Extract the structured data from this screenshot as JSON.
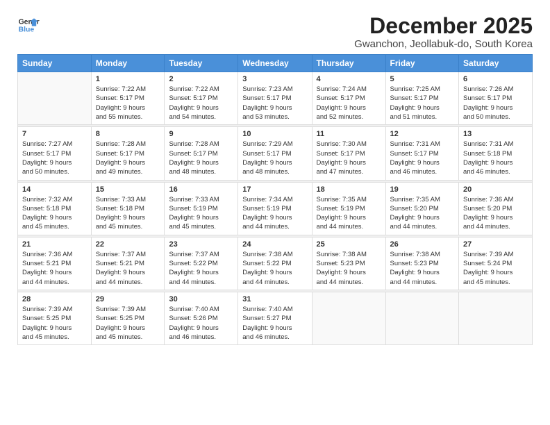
{
  "logo": {
    "general": "General",
    "blue": "Blue"
  },
  "title": "December 2025",
  "subtitle": "Gwanchon, Jeollabuk-do, South Korea",
  "days_header": [
    "Sunday",
    "Monday",
    "Tuesday",
    "Wednesday",
    "Thursday",
    "Friday",
    "Saturday"
  ],
  "weeks": [
    [
      {
        "day": "",
        "info": ""
      },
      {
        "day": "1",
        "info": "Sunrise: 7:22 AM\nSunset: 5:17 PM\nDaylight: 9 hours\nand 55 minutes."
      },
      {
        "day": "2",
        "info": "Sunrise: 7:22 AM\nSunset: 5:17 PM\nDaylight: 9 hours\nand 54 minutes."
      },
      {
        "day": "3",
        "info": "Sunrise: 7:23 AM\nSunset: 5:17 PM\nDaylight: 9 hours\nand 53 minutes."
      },
      {
        "day": "4",
        "info": "Sunrise: 7:24 AM\nSunset: 5:17 PM\nDaylight: 9 hours\nand 52 minutes."
      },
      {
        "day": "5",
        "info": "Sunrise: 7:25 AM\nSunset: 5:17 PM\nDaylight: 9 hours\nand 51 minutes."
      },
      {
        "day": "6",
        "info": "Sunrise: 7:26 AM\nSunset: 5:17 PM\nDaylight: 9 hours\nand 50 minutes."
      }
    ],
    [
      {
        "day": "7",
        "info": "Sunrise: 7:27 AM\nSunset: 5:17 PM\nDaylight: 9 hours\nand 50 minutes."
      },
      {
        "day": "8",
        "info": "Sunrise: 7:28 AM\nSunset: 5:17 PM\nDaylight: 9 hours\nand 49 minutes."
      },
      {
        "day": "9",
        "info": "Sunrise: 7:28 AM\nSunset: 5:17 PM\nDaylight: 9 hours\nand 48 minutes."
      },
      {
        "day": "10",
        "info": "Sunrise: 7:29 AM\nSunset: 5:17 PM\nDaylight: 9 hours\nand 48 minutes."
      },
      {
        "day": "11",
        "info": "Sunrise: 7:30 AM\nSunset: 5:17 PM\nDaylight: 9 hours\nand 47 minutes."
      },
      {
        "day": "12",
        "info": "Sunrise: 7:31 AM\nSunset: 5:17 PM\nDaylight: 9 hours\nand 46 minutes."
      },
      {
        "day": "13",
        "info": "Sunrise: 7:31 AM\nSunset: 5:18 PM\nDaylight: 9 hours\nand 46 minutes."
      }
    ],
    [
      {
        "day": "14",
        "info": "Sunrise: 7:32 AM\nSunset: 5:18 PM\nDaylight: 9 hours\nand 45 minutes."
      },
      {
        "day": "15",
        "info": "Sunrise: 7:33 AM\nSunset: 5:18 PM\nDaylight: 9 hours\nand 45 minutes."
      },
      {
        "day": "16",
        "info": "Sunrise: 7:33 AM\nSunset: 5:19 PM\nDaylight: 9 hours\nand 45 minutes."
      },
      {
        "day": "17",
        "info": "Sunrise: 7:34 AM\nSunset: 5:19 PM\nDaylight: 9 hours\nand 44 minutes."
      },
      {
        "day": "18",
        "info": "Sunrise: 7:35 AM\nSunset: 5:19 PM\nDaylight: 9 hours\nand 44 minutes."
      },
      {
        "day": "19",
        "info": "Sunrise: 7:35 AM\nSunset: 5:20 PM\nDaylight: 9 hours\nand 44 minutes."
      },
      {
        "day": "20",
        "info": "Sunrise: 7:36 AM\nSunset: 5:20 PM\nDaylight: 9 hours\nand 44 minutes."
      }
    ],
    [
      {
        "day": "21",
        "info": "Sunrise: 7:36 AM\nSunset: 5:21 PM\nDaylight: 9 hours\nand 44 minutes."
      },
      {
        "day": "22",
        "info": "Sunrise: 7:37 AM\nSunset: 5:21 PM\nDaylight: 9 hours\nand 44 minutes."
      },
      {
        "day": "23",
        "info": "Sunrise: 7:37 AM\nSunset: 5:22 PM\nDaylight: 9 hours\nand 44 minutes."
      },
      {
        "day": "24",
        "info": "Sunrise: 7:38 AM\nSunset: 5:22 PM\nDaylight: 9 hours\nand 44 minutes."
      },
      {
        "day": "25",
        "info": "Sunrise: 7:38 AM\nSunset: 5:23 PM\nDaylight: 9 hours\nand 44 minutes."
      },
      {
        "day": "26",
        "info": "Sunrise: 7:38 AM\nSunset: 5:23 PM\nDaylight: 9 hours\nand 44 minutes."
      },
      {
        "day": "27",
        "info": "Sunrise: 7:39 AM\nSunset: 5:24 PM\nDaylight: 9 hours\nand 45 minutes."
      }
    ],
    [
      {
        "day": "28",
        "info": "Sunrise: 7:39 AM\nSunset: 5:25 PM\nDaylight: 9 hours\nand 45 minutes."
      },
      {
        "day": "29",
        "info": "Sunrise: 7:39 AM\nSunset: 5:25 PM\nDaylight: 9 hours\nand 45 minutes."
      },
      {
        "day": "30",
        "info": "Sunrise: 7:40 AM\nSunset: 5:26 PM\nDaylight: 9 hours\nand 46 minutes."
      },
      {
        "day": "31",
        "info": "Sunrise: 7:40 AM\nSunset: 5:27 PM\nDaylight: 9 hours\nand 46 minutes."
      },
      {
        "day": "",
        "info": ""
      },
      {
        "day": "",
        "info": ""
      },
      {
        "day": "",
        "info": ""
      }
    ]
  ]
}
